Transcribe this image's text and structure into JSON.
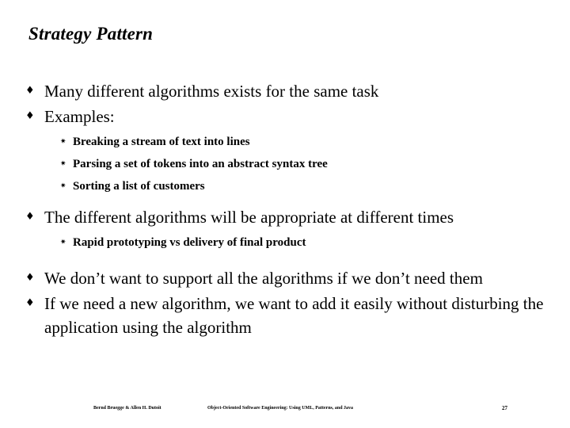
{
  "slide": {
    "title": "Strategy Pattern",
    "bullet_marker": "♦",
    "sub_bullet_marker": "✷",
    "blocks": [
      {
        "level": 1,
        "text": "Many different algorithms exists for the same task"
      },
      {
        "level": 1,
        "text": "Examples:"
      },
      {
        "level": 2,
        "text": "Breaking a stream of text into lines"
      },
      {
        "level": 2,
        "text": "Parsing a set of tokens into an abstract syntax tree"
      },
      {
        "level": 2,
        "text": "Sorting a list of customers"
      },
      {
        "level": 1,
        "text": "The different algorithms will be appropriate at different times"
      },
      {
        "level": 2,
        "text": "Rapid prototyping vs delivery of final product"
      },
      {
        "level": 1,
        "text": "We don’t want to support all the algorithms if we don’t need them"
      },
      {
        "level": 1,
        "text": "If we need a new algorithm, we want to add it easily without disturbing the application using the algorithm"
      }
    ]
  },
  "footer": {
    "left": "Bernd Bruegge & Allen H. Dutoit",
    "center": "Object-Oriented Software Engineering: Using UML, Patterns, and Java",
    "page": "27"
  }
}
